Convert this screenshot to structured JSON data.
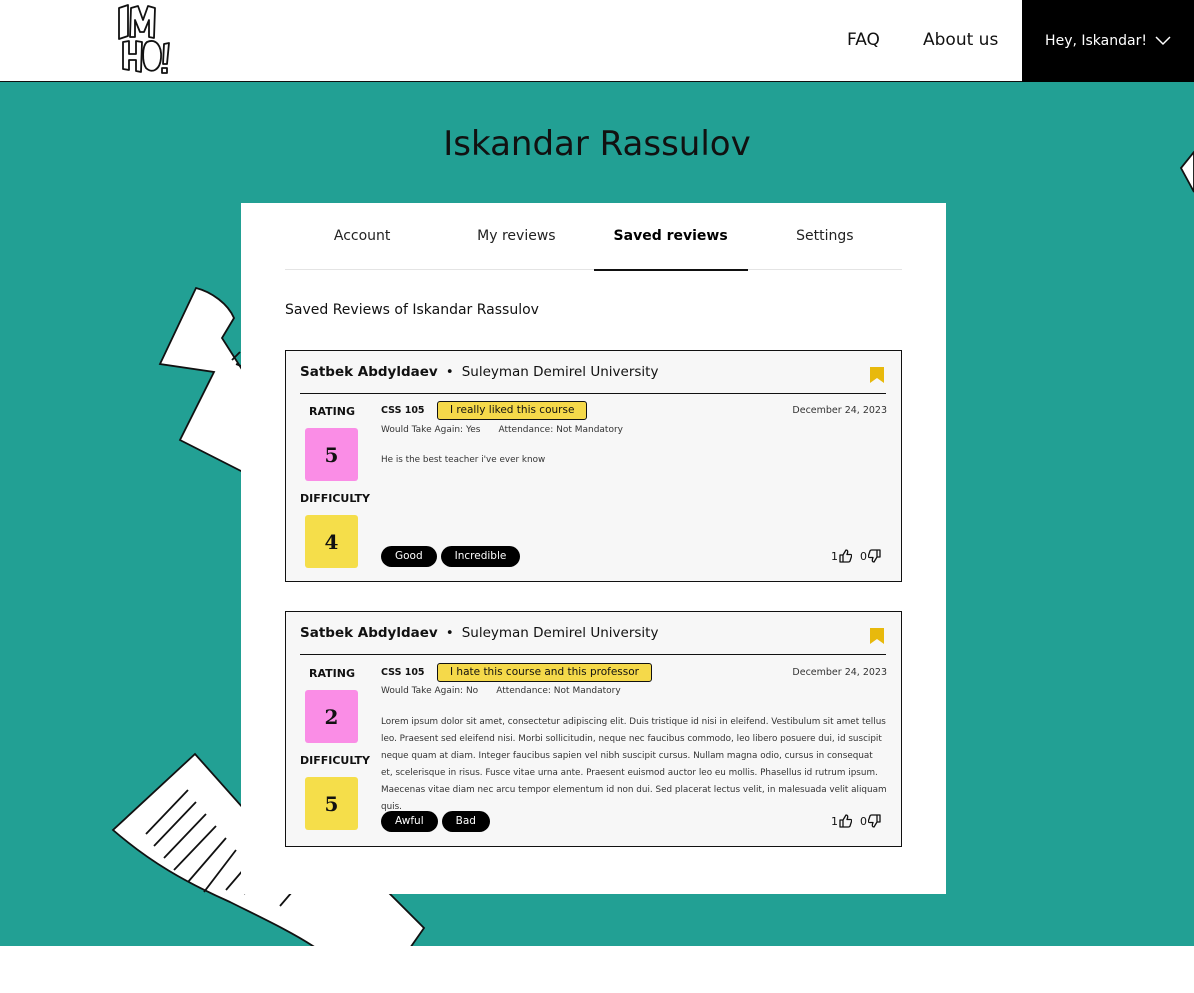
{
  "header": {
    "nav": [
      {
        "label": "FAQ"
      },
      {
        "label": "About us"
      }
    ],
    "user_greeting": "Hey, Iskandar!"
  },
  "profile": {
    "name": "Iskandar Rassulov"
  },
  "tabs": [
    {
      "label": "Account",
      "active": false
    },
    {
      "label": "My reviews",
      "active": false
    },
    {
      "label": "Saved reviews",
      "active": true
    },
    {
      "label": "Settings",
      "active": false
    }
  ],
  "section_title": "Saved Reviews of Iskandar Rassulov",
  "score_labels": {
    "rating": "RATING",
    "difficulty": "DIFFICULTY"
  },
  "reviews": [
    {
      "professor": "Satbek Abdyldaev",
      "separator": "•",
      "university": "Suleyman Demirel University",
      "rating": "5",
      "difficulty": "4",
      "course": "CSS 105",
      "feeling": "I really liked this course",
      "date": "December 24, 2023",
      "would_take_again": "Would Take Again: Yes",
      "attendance": "Attendance: Not Mandatory",
      "comment": "He is the best teacher i've ever know",
      "tags": [
        "Good",
        "Incredible"
      ],
      "likes": "1",
      "dislikes": "0"
    },
    {
      "professor": "Satbek Abdyldaev",
      "separator": "•",
      "university": "Suleyman Demirel University",
      "rating": "2",
      "difficulty": "5",
      "course": "CSS 105",
      "feeling": "I hate this course and this professor",
      "date": "December 24, 2023",
      "would_take_again": "Would Take Again: No",
      "attendance": "Attendance: Not Mandatory",
      "comment": "Lorem ipsum dolor sit amet, consectetur adipiscing elit. Duis tristique id nisi in eleifend. Vestibulum sit amet tellus leo. Praesent sed eleifend nisi. Morbi sollicitudin, neque nec faucibus commodo, leo libero posuere dui, id suscipit neque quam at diam. Integer faucibus sapien vel nibh suscipit cursus. Nullam magna odio, cursus in consequat et, scelerisque in risus. Fusce vitae urna ante. Praesent euismod auctor leo eu mollis. Phasellus id rutrum ipsum. Maecenas vitae diam nec arcu tempor elementum id non dui. Sed placerat lectus velit, in malesuada velit aliquam quis.",
      "tags": [
        "Awful",
        "Bad"
      ],
      "likes": "1",
      "dislikes": "0"
    }
  ],
  "colors": {
    "teal": "#22a094",
    "rating_box": "#fa8de6",
    "difficulty_box": "#f5de4a",
    "feeling_badge": "#f5d94a",
    "bookmark": "#e8b90c",
    "card_bg": "#f7f7f7"
  },
  "icons": [
    "logo",
    "chevron-down-icon",
    "bookmark-icon",
    "thumbs-up-icon",
    "thumbs-down-icon"
  ]
}
